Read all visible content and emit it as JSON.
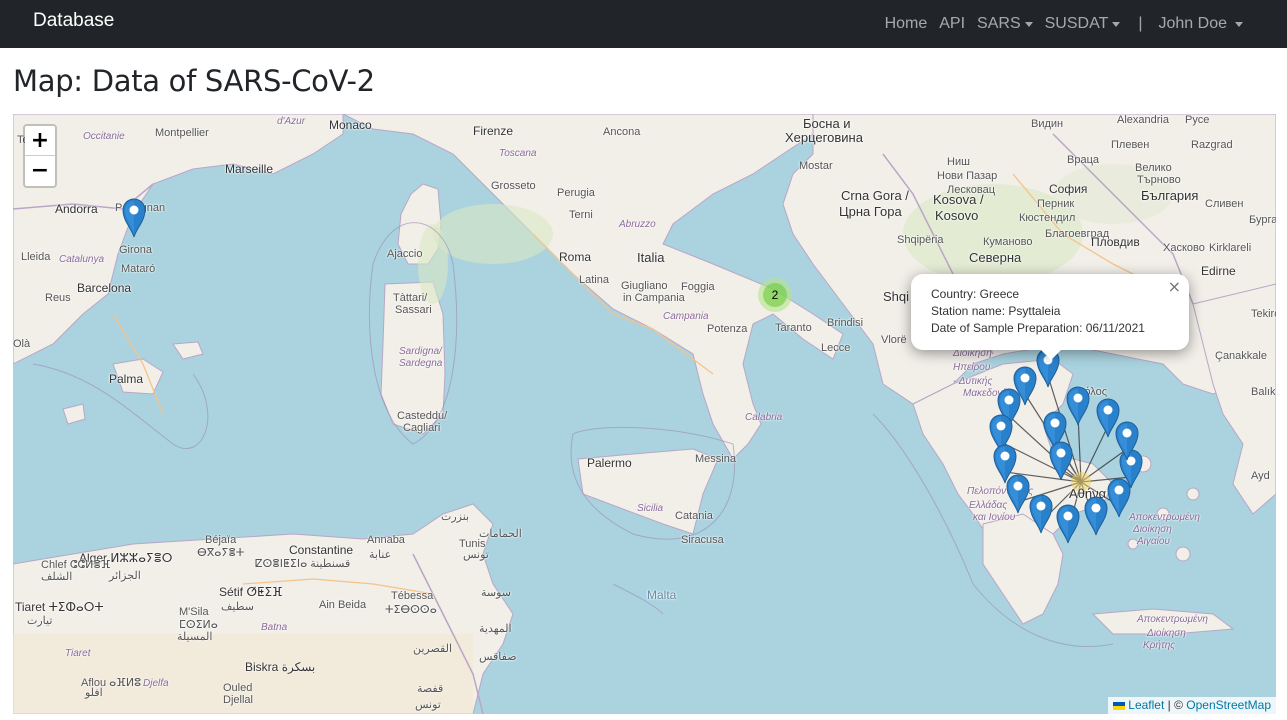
{
  "navbar": {
    "brand": "Database",
    "items": [
      {
        "label": "Home"
      },
      {
        "label": "API"
      },
      {
        "label": "SARS",
        "dropdown": true
      },
      {
        "label": "SUSDAT",
        "dropdown": true
      }
    ],
    "separator": "|",
    "user": "John Doe"
  },
  "page": {
    "title": "Map: Data of SARS-CoV-2"
  },
  "map": {
    "zoom_in": "+",
    "zoom_out": "−",
    "cluster_count": "2",
    "popup": {
      "close": "×",
      "line1": "Country: Greece",
      "line2": "Station name: Psyttaleia",
      "line3": "Date of Sample Preparation: 06/11/2021"
    },
    "attribution": {
      "leaflet": "Leaflet",
      "separator": " | © ",
      "osm": "OpenStreetMap"
    },
    "labels": [
      {
        "text": "Monaco",
        "cls": "city"
      },
      {
        "text": "Firenze",
        "cls": "city"
      },
      {
        "text": "Ancona",
        "cls": ""
      },
      {
        "text": "Marseille",
        "cls": "city"
      },
      {
        "text": "Montpellier",
        "cls": ""
      },
      {
        "text": "Occitanie",
        "cls": "region"
      },
      {
        "text": "Andorra",
        "cls": "city"
      },
      {
        "text": "Perpignan",
        "cls": ""
      },
      {
        "text": "Girona",
        "cls": ""
      },
      {
        "text": "Lleida",
        "cls": ""
      },
      {
        "text": "Catalunya",
        "cls": "region"
      },
      {
        "text": "Mataró",
        "cls": ""
      },
      {
        "text": "Barcelona",
        "cls": "city"
      },
      {
        "text": "Reus",
        "cls": ""
      },
      {
        "text": "Palma",
        "cls": "city"
      },
      {
        "text": "Ajaccio",
        "cls": ""
      },
      {
        "text": "Tàttari/",
        "cls": ""
      },
      {
        "text": "Sassari",
        "cls": ""
      },
      {
        "text": "Sardigna/",
        "cls": "region"
      },
      {
        "text": "Sardegna",
        "cls": "region"
      },
      {
        "text": "Casteddu/",
        "cls": ""
      },
      {
        "text": "Cagliari",
        "cls": ""
      },
      {
        "text": "Grosseto",
        "cls": ""
      },
      {
        "text": "Toscana",
        "cls": "region"
      },
      {
        "text": "Perugia",
        "cls": ""
      },
      {
        "text": "Terni",
        "cls": ""
      },
      {
        "text": "Abruzzo",
        "cls": "region"
      },
      {
        "text": "Roma",
        "cls": "city"
      },
      {
        "text": "Italia",
        "cls": "big"
      },
      {
        "text": "Latina",
        "cls": ""
      },
      {
        "text": "Giugliano",
        "cls": ""
      },
      {
        "text": "in Campania",
        "cls": ""
      },
      {
        "text": "Foggia",
        "cls": ""
      },
      {
        "text": "Campania",
        "cls": "region"
      },
      {
        "text": "Potenza",
        "cls": ""
      },
      {
        "text": "Taranto",
        "cls": ""
      },
      {
        "text": "Brindisi",
        "cls": ""
      },
      {
        "text": "Lecce",
        "cls": ""
      },
      {
        "text": "Calabria",
        "cls": "region"
      },
      {
        "text": "Palermo",
        "cls": "city"
      },
      {
        "text": "Messina",
        "cls": ""
      },
      {
        "text": "Sicilia",
        "cls": "region"
      },
      {
        "text": "Catania",
        "cls": ""
      },
      {
        "text": "Siracusa",
        "cls": ""
      },
      {
        "text": "Malta",
        "cls": "sea"
      },
      {
        "text": "Босна и",
        "cls": "big"
      },
      {
        "text": "Херцеговина",
        "cls": "big"
      },
      {
        "text": "Mostar",
        "cls": ""
      },
      {
        "text": "Crna Gora /",
        "cls": "big"
      },
      {
        "text": "Црна Гора",
        "cls": "big"
      },
      {
        "text": "Kosova /",
        "cls": "big"
      },
      {
        "text": "Kosovo",
        "cls": "big"
      },
      {
        "text": "Shqipëria",
        "cls": ""
      },
      {
        "text": "Видин",
        "cls": ""
      },
      {
        "text": "Alexandria",
        "cls": ""
      },
      {
        "text": "Русе",
        "cls": ""
      },
      {
        "text": "Плевен",
        "cls": ""
      },
      {
        "text": "Razgrad",
        "cls": ""
      },
      {
        "text": "Враца",
        "cls": ""
      },
      {
        "text": "Ниш",
        "cls": ""
      },
      {
        "text": "Нови Пазар",
        "cls": ""
      },
      {
        "text": "Лесковац",
        "cls": ""
      },
      {
        "text": "Велико",
        "cls": ""
      },
      {
        "text": "Търново",
        "cls": ""
      },
      {
        "text": "София",
        "cls": "city"
      },
      {
        "text": "България",
        "cls": "big"
      },
      {
        "text": "Перник",
        "cls": ""
      },
      {
        "text": "Сливен",
        "cls": ""
      },
      {
        "text": "Бургас",
        "cls": ""
      },
      {
        "text": "Кюстендил",
        "cls": ""
      },
      {
        "text": "Благоевград",
        "cls": ""
      },
      {
        "text": "Куманово",
        "cls": ""
      },
      {
        "text": "Пловдив",
        "cls": "city"
      },
      {
        "text": "Хасково",
        "cls": ""
      },
      {
        "text": "Kirklareli",
        "cls": ""
      },
      {
        "text": "Северна",
        "cls": "big"
      },
      {
        "text": "Edirne",
        "cls": "city"
      },
      {
        "text": "Tekirdağ",
        "cls": ""
      },
      {
        "text": "Çanakkale",
        "cls": ""
      },
      {
        "text": "Balık",
        "cls": ""
      },
      {
        "text": "Ayd",
        "cls": ""
      },
      {
        "text": "Vlorë",
        "cls": ""
      },
      {
        "text": "Alger ⵍⵣⵣⴰⵢⴻⵔ",
        "cls": "city"
      },
      {
        "text": "الجزائر",
        "cls": ""
      },
      {
        "text": "Chlef ⵛⵛⵍⴻⴼ",
        "cls": ""
      },
      {
        "text": "الشلف",
        "cls": ""
      },
      {
        "text": "Béjaïa",
        "cls": ""
      },
      {
        "text": "ⴱⴳⴰⵢⴻⵜ",
        "cls": ""
      },
      {
        "text": "Constantine",
        "cls": "city"
      },
      {
        "text": "ⵇⵙⴻⵏⵟⵉⵏⴰ قسنطينة",
        "cls": ""
      },
      {
        "text": "Annaba",
        "cls": ""
      },
      {
        "text": "عنابة",
        "cls": ""
      },
      {
        "text": "Sétif ⵚⵟⵉⴼ",
        "cls": "city"
      },
      {
        "text": "سطيف",
        "cls": ""
      },
      {
        "text": "Ain Beida",
        "cls": ""
      },
      {
        "text": "Tébessa",
        "cls": ""
      },
      {
        "text": "ⵜⵉⴱⵙⵙⴰ",
        "cls": ""
      },
      {
        "text": "M'Sila",
        "cls": ""
      },
      {
        "text": "ⵎⵙⵉⵍⴰ",
        "cls": ""
      },
      {
        "text": "المسيلة",
        "cls": ""
      },
      {
        "text": "Batna",
        "cls": "region"
      },
      {
        "text": "Tiaret ⵜⵉⵀⴰⵔⵜ",
        "cls": "city"
      },
      {
        "text": "تيارت",
        "cls": ""
      },
      {
        "text": "Tiaret",
        "cls": "region"
      },
      {
        "text": "Biskra بسكرة",
        "cls": "city"
      },
      {
        "text": "Aflou ⴰⴼⵍⵓ",
        "cls": ""
      },
      {
        "text": "افلو",
        "cls": ""
      },
      {
        "text": "Djelfa",
        "cls": "region"
      },
      {
        "text": "Ouled",
        "cls": ""
      },
      {
        "text": "Djellal",
        "cls": ""
      },
      {
        "text": "Tunis",
        "cls": ""
      },
      {
        "text": "تونس",
        "cls": ""
      },
      {
        "text": "بنزرت",
        "cls": ""
      },
      {
        "text": "الحمامات",
        "cls": ""
      },
      {
        "text": "سوسة",
        "cls": ""
      },
      {
        "text": "المهدية",
        "cls": ""
      },
      {
        "text": "صفاقس",
        "cls": ""
      },
      {
        "text": "القصرين",
        "cls": ""
      },
      {
        "text": "قفصة",
        "cls": ""
      },
      {
        "text": "تونس",
        "cls": ""
      },
      {
        "text": "Αθήνα",
        "cls": "big"
      },
      {
        "text": "Βόλος",
        "cls": ""
      },
      {
        "text": "Διοίκηση",
        "cls": "region"
      },
      {
        "text": "Ηπείρου",
        "cls": "region"
      },
      {
        "text": "- Δυτικής",
        "cls": "region"
      },
      {
        "text": "Μακεδονίας",
        "cls": "region"
      },
      {
        "text": "Πελοπόννησος",
        "cls": "region"
      },
      {
        "text": "Ελλάδας",
        "cls": "region"
      },
      {
        "text": "και Ιονίου",
        "cls": "region"
      },
      {
        "text": "Αποκεντρωμένη",
        "cls": "region"
      },
      {
        "text": "Διοίκηση",
        "cls": "region"
      },
      {
        "text": "Αιγαίου",
        "cls": "region"
      },
      {
        "text": "Αποκεντρωμένη",
        "cls": "region"
      },
      {
        "text": "Διοίκηση",
        "cls": "region"
      },
      {
        "text": "Κρήτης",
        "cls": "region"
      },
      {
        "text": "Te",
        "cls": ""
      },
      {
        "text": "se",
        "cls": ""
      },
      {
        "text": "d'Azur",
        "cls": "region"
      },
      {
        "text": "Olà",
        "cls": ""
      },
      {
        "text": "Shqi",
        "cls": "big"
      }
    ]
  }
}
